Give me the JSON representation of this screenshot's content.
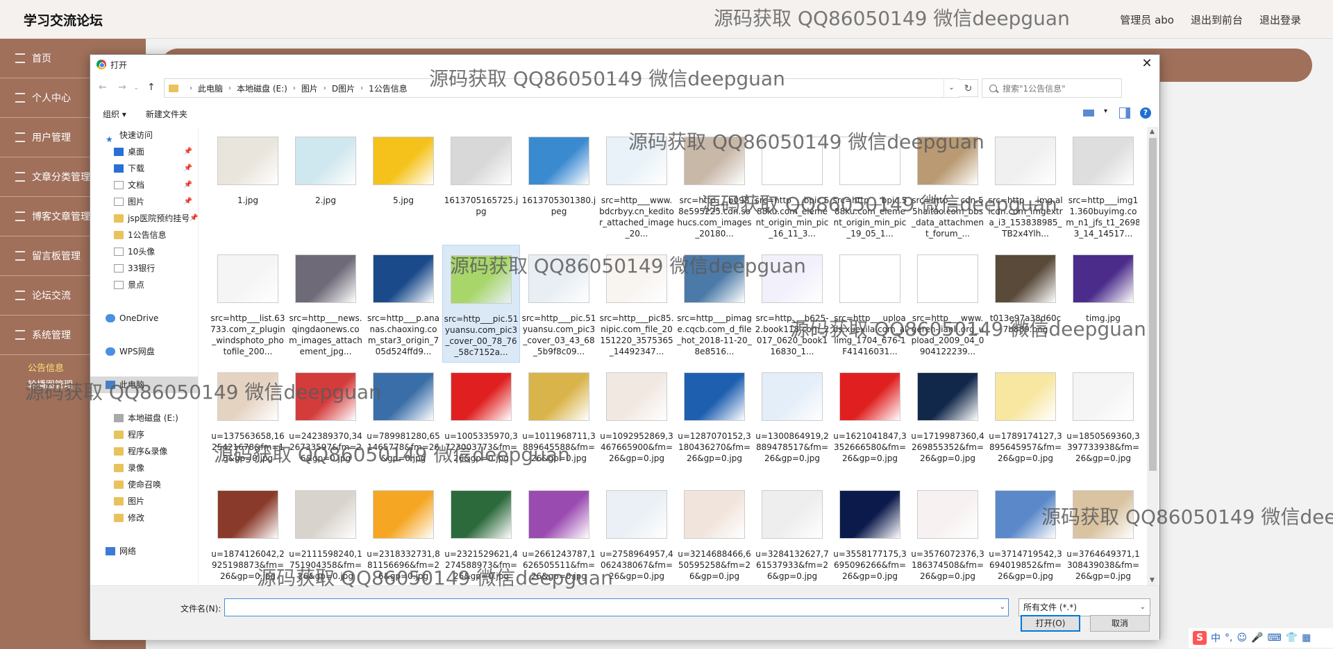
{
  "app": {
    "brand": "学习交流论坛",
    "watermark": "源码获取 QQ86050149 微信deepguan",
    "top_links": [
      "管理员 abo",
      "退出到前台",
      "退出登录"
    ]
  },
  "sidebar": {
    "items": [
      {
        "label": "首页",
        "icon": "home-icon"
      },
      {
        "label": "个人中心",
        "icon": "user-icon"
      },
      {
        "label": "用户管理",
        "icon": "list-icon"
      },
      {
        "label": "文章分类管理",
        "icon": "list-icon"
      },
      {
        "label": "博客文章管理",
        "icon": "list-icon"
      },
      {
        "label": "留言板管理",
        "icon": "list-icon"
      },
      {
        "label": "论坛交流",
        "icon": "list-icon"
      },
      {
        "label": "系统管理",
        "icon": "list-icon"
      }
    ],
    "sub_items": [
      "公告信息",
      "轮播图管理"
    ]
  },
  "dialog": {
    "title": "打开",
    "breadcrumb": [
      "此电脑",
      "本地磁盘 (E:)",
      "图片",
      "D图片",
      "1公告信息"
    ],
    "search_placeholder": "搜索\"1公告信息\"",
    "toolbar": {
      "organize": "组织 ▾",
      "new_folder": "新建文件夹"
    },
    "nav": [
      {
        "label": "快速访问",
        "icon": "star",
        "indent": 0,
        "pin": false
      },
      {
        "label": "桌面",
        "icon": "blue",
        "indent": 1,
        "pin": true
      },
      {
        "label": "下载",
        "icon": "blue",
        "indent": 1,
        "pin": true
      },
      {
        "label": "文档",
        "icon": "doc",
        "indent": 1,
        "pin": true
      },
      {
        "label": "图片",
        "icon": "doc",
        "indent": 1,
        "pin": true
      },
      {
        "label": "jsp医院预约挂号",
        "icon": "fold",
        "indent": 1,
        "pin": true
      },
      {
        "label": "1公告信息",
        "icon": "fold",
        "indent": 1,
        "pin": false
      },
      {
        "label": "10头像",
        "icon": "doc",
        "indent": 1,
        "pin": false
      },
      {
        "label": "33银行",
        "icon": "doc",
        "indent": 1,
        "pin": false
      },
      {
        "label": "景点",
        "icon": "doc",
        "indent": 1,
        "pin": false
      },
      {
        "label": "",
        "icon": "none",
        "indent": 0,
        "pin": false
      },
      {
        "label": "OneDrive",
        "icon": "cloud",
        "indent": 0,
        "pin": false
      },
      {
        "label": "",
        "icon": "none",
        "indent": 0,
        "pin": false
      },
      {
        "label": "WPS网盘",
        "icon": "cloud",
        "indent": 0,
        "pin": false
      },
      {
        "label": "",
        "icon": "none",
        "indent": 0,
        "pin": false
      },
      {
        "label": "此电脑",
        "icon": "pc",
        "indent": 0,
        "pin": false,
        "selected": true
      },
      {
        "label": "",
        "icon": "none",
        "indent": 0,
        "pin": false
      },
      {
        "label": "本地磁盘 (E:)",
        "icon": "drive",
        "indent": 1,
        "pin": false
      },
      {
        "label": "程序",
        "icon": "fold",
        "indent": 1,
        "pin": false
      },
      {
        "label": "程序&录像",
        "icon": "fold",
        "indent": 1,
        "pin": false
      },
      {
        "label": "录像",
        "icon": "fold",
        "indent": 1,
        "pin": false
      },
      {
        "label": "使命召唤",
        "icon": "fold",
        "indent": 1,
        "pin": false
      },
      {
        "label": "图片",
        "icon": "fold",
        "indent": 1,
        "pin": false
      },
      {
        "label": "修改",
        "icon": "fold",
        "indent": 1,
        "pin": false
      },
      {
        "label": "",
        "icon": "none",
        "indent": 0,
        "pin": false
      },
      {
        "label": "网络",
        "icon": "net",
        "indent": 0,
        "pin": false
      }
    ],
    "files": [
      {
        "name": "1.jpg",
        "color": "#e9e4dc"
      },
      {
        "name": "2.jpg",
        "color": "#cfe7ee"
      },
      {
        "name": "5.jpg",
        "color": "#f4c21a"
      },
      {
        "name": "1613705165725.jpg",
        "color": "#d8d8d8"
      },
      {
        "name": "1613705301380.jpeg",
        "color": "#3a8ad0"
      },
      {
        "name": "src=http___www.bdcrbyy.cn_keditor_attached_image_20...",
        "color": "#e9f2f8"
      },
      {
        "name": "src=http___b0988e595225.cdn.sohucs.com_images_20180...",
        "color": "#c8b8a8"
      },
      {
        "name": "src=http___bpic.588ku.com_element_origin_min_pic_16_11_3...",
        "color": "#ffffff"
      },
      {
        "name": "src=http___bpic.588ku.com_element_origin_min_pic_19_05_1...",
        "color": "#ffffff"
      },
      {
        "name": "src=http___cdn.55haitao.com_bbs_data_attachment_forum_...",
        "color": "#b99a72"
      },
      {
        "name": "src=http___img.alicdn.com_imgextra_i3_153838985_TB2x4Ylh...",
        "color": "#f0f0f0"
      },
      {
        "name": "src=http___img11.360buyimg.com_n1_jfs_t1_26983_14_14517...",
        "color": "#dedede"
      },
      {
        "name": "src=http___list.63733.com_z_plugin_windsphoto_photofile_200...",
        "color": "#f5f5f5"
      },
      {
        "name": "src=http___news.qingdaonews.com_images_attachement_jpg...",
        "color": "#6e6a78"
      },
      {
        "name": "src=http___p.ananas.chaoxing.com_star3_origin_705d524ffd9...",
        "color": "#1a4a8a"
      },
      {
        "name": "src=http___pic.51yuansu.com_pic3_cover_00_78_76_58c7152a...",
        "color": "#a8d66a",
        "selected": true
      },
      {
        "name": "src=http___pic.51yuansu.com_pic3_cover_03_43_68_5b9f8c09...",
        "color": "#e8eef4"
      },
      {
        "name": "src=http___pic85.nipic.com_file_20151220_3575365_14492347...",
        "color": "#f8f4f0"
      },
      {
        "name": "src=http___pimage.cqcb.com_d_file_hot_2018-11-20_8e8516...",
        "color": "#4c7aa8"
      },
      {
        "name": "src=http___b625-2.book118.com_2017_0620_book116830_1...",
        "color": "#f2f0fb"
      },
      {
        "name": "src=http___uploads.xuexila.com_allimg_1704_676-1F41416031...",
        "color": "#ffffff"
      },
      {
        "name": "src=http___www.geren-jianli.org_upload_2009_04_0904122239...",
        "color": "#ffffff"
      },
      {
        "name": "t013e97a38d60c7b889.png",
        "color": "#5a4a3a"
      },
      {
        "name": "timg.jpg",
        "color": "#4b2c8a"
      },
      {
        "name": "u=137563658,1625421678&fm=15&gp=0.jpg",
        "color": "#e5d3c2"
      },
      {
        "name": "u=242389370,3426733597&fm=26&gp=0.jpg",
        "color": "#d43b3b"
      },
      {
        "name": "u=789981280,651465778&fm=26&gp=0.jpg",
        "color": "#3a6ea8"
      },
      {
        "name": "u=1005335970,3723003773&fm=26&gp=0.jpg",
        "color": "#e02020"
      },
      {
        "name": "u=1011968711,3889645588&fm=26&gp=0.jpg",
        "color": "#d9b44a"
      },
      {
        "name": "u=1092952869,3467665900&fm=26&gp=0.jpg",
        "color": "#f2e8e2"
      },
      {
        "name": "u=1287070152,3180436270&fm=26&gp=0.jpg",
        "color": "#1e5fb0"
      },
      {
        "name": "u=1300864919,2889478517&fm=26&gp=0.jpg",
        "color": "#e4eef8"
      },
      {
        "name": "u=1621041847,3352666580&fm=26&gp=0.jpg",
        "color": "#e02020"
      },
      {
        "name": "u=1719987360,4269855352&fm=26&gp=0.jpg",
        "color": "#12284a"
      },
      {
        "name": "u=1789174127,3895645957&fm=26&gp=0.jpg",
        "color": "#f7e7a0"
      },
      {
        "name": "u=1850569360,3397733938&fm=26&gp=0.jpg",
        "color": "#f5f5f5"
      },
      {
        "name": "u=1874126042,2925198873&fm=26&gp=0.jpg",
        "color": "#8a3a2a"
      },
      {
        "name": "u=2111598240,1751904358&fm=26&gp=0.jpg",
        "color": "#d8d3cc"
      },
      {
        "name": "u=2318332731,881156696&fm=26&gp=0.jpg",
        "color": "#f5a623"
      },
      {
        "name": "u=2321529621,4274588973&fm=26&gp=0.jpg",
        "color": "#2c6a3c"
      },
      {
        "name": "u=2661243787,1626505511&fm=26&gp=0.jpg",
        "color": "#9a4bb0"
      },
      {
        "name": "u=2758964957,4062438067&fm=26&gp=0.jpg",
        "color": "#eaf0f6"
      },
      {
        "name": "u=3214688466,650595258&fm=26&gp=0.jpg",
        "color": "#f1e4dc"
      },
      {
        "name": "u=3284132627,761537933&fm=26&gp=0.jpg",
        "color": "#eeeeee"
      },
      {
        "name": "u=3558177175,3695096266&fm=26&gp=0.jpg",
        "color": "#0b1a4a"
      },
      {
        "name": "u=3576072376,3186374508&fm=26&gp=0.jpg",
        "color": "#f7f1f1"
      },
      {
        "name": "u=3714719542,3694019852&fm=26&gp=0.jpg",
        "color": "#5a88c8"
      },
      {
        "name": "u=3764649371,1308439038&fm=26&gp=0.jpg",
        "color": "#d9c3a0"
      }
    ],
    "filename_label": "文件名(N):",
    "filename_value": "",
    "filetype": "所有文件 (*.*)",
    "open_label": "打开(O)",
    "cancel_label": "取消"
  },
  "ime": {
    "labels": [
      "S",
      "中",
      "°,",
      "☺",
      "🎤",
      "⌨",
      "👕",
      "▦"
    ]
  }
}
